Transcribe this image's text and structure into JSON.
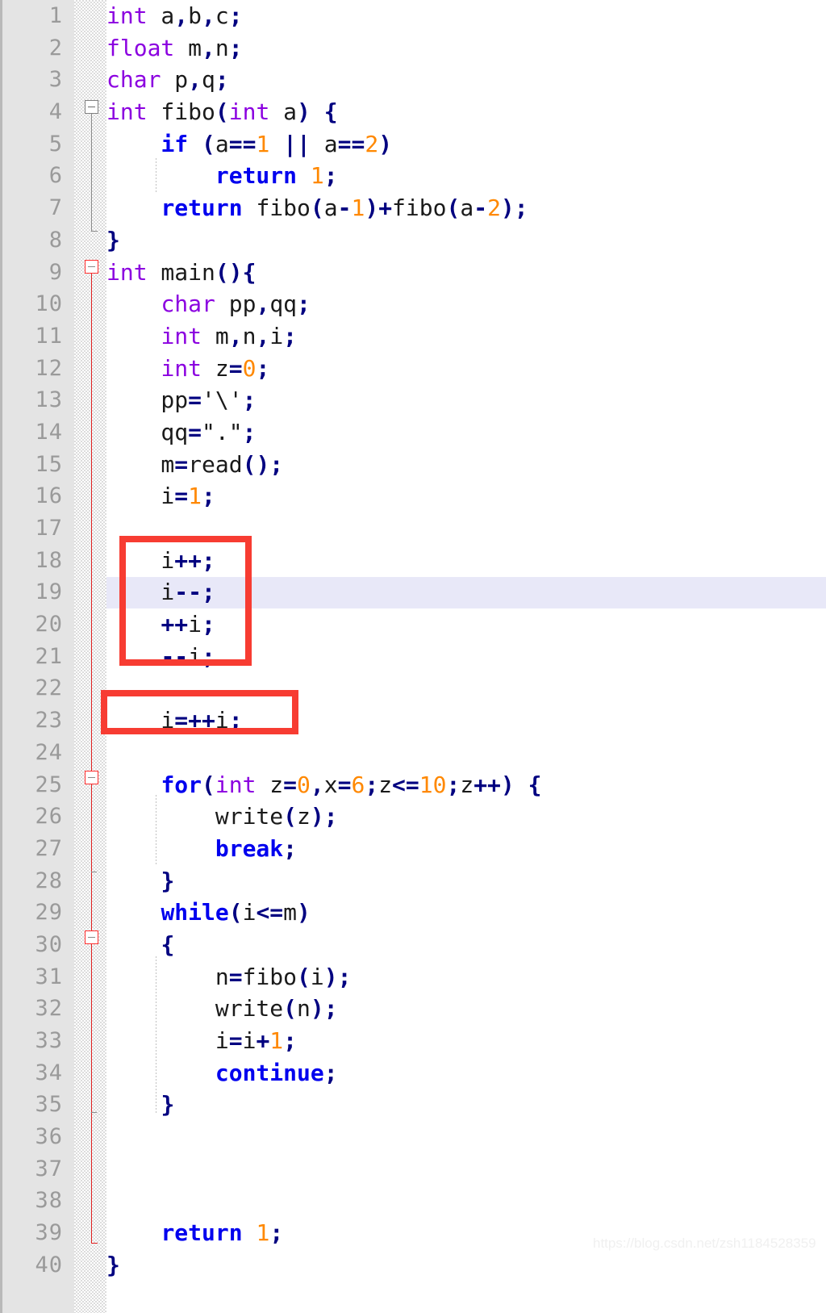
{
  "editor": {
    "language": "c",
    "first_line": 1,
    "last_line": 40,
    "highlighted_line": 19,
    "colors": {
      "background": "#ffffff",
      "gutter_background": "#e4e4e4",
      "line_number": "#9a9a9a",
      "current_line_highlight": "#e8e8f8",
      "type_keyword": "#8b00e0",
      "control_keyword": "#0000ee",
      "number_literal": "#ff8800",
      "punctuation": "#000080",
      "plain_text": "#1a1a1a",
      "annotation_box": "#f73c32",
      "scope_line_active": "#e02020",
      "scope_line_inactive": "#8a8a8a",
      "watermark": "#f0f0f0"
    }
  },
  "line_numbers": [
    "1",
    "2",
    "3",
    "4",
    "5",
    "6",
    "7",
    "8",
    "9",
    "10",
    "11",
    "12",
    "13",
    "14",
    "15",
    "16",
    "17",
    "18",
    "19",
    "20",
    "21",
    "22",
    "23",
    "24",
    "25",
    "26",
    "27",
    "28",
    "29",
    "30",
    "31",
    "32",
    "33",
    "34",
    "35",
    "36",
    "37",
    "38",
    "39",
    "40"
  ],
  "code_lines": [
    {
      "n": 1,
      "text": "int a,b,c;"
    },
    {
      "n": 2,
      "text": "float m,n;"
    },
    {
      "n": 3,
      "text": "char p,q;"
    },
    {
      "n": 4,
      "text": "int fibo(int a) {"
    },
    {
      "n": 5,
      "text": "    if (a==1 || a==2)"
    },
    {
      "n": 6,
      "text": "        return 1;"
    },
    {
      "n": 7,
      "text": "    return fibo(a-1)+fibo(a-2);"
    },
    {
      "n": 8,
      "text": "}"
    },
    {
      "n": 9,
      "text": "int main(){"
    },
    {
      "n": 10,
      "text": "    char pp,qq;"
    },
    {
      "n": 11,
      "text": "    int m,n,i;"
    },
    {
      "n": 12,
      "text": "    int z=0;"
    },
    {
      "n": 13,
      "text": "    pp='\\';"
    },
    {
      "n": 14,
      "text": "    qq=\".\";"
    },
    {
      "n": 15,
      "text": "    m=read();"
    },
    {
      "n": 16,
      "text": "    i=1;"
    },
    {
      "n": 17,
      "text": ""
    },
    {
      "n": 18,
      "text": "    i++;"
    },
    {
      "n": 19,
      "text": "    i--;"
    },
    {
      "n": 20,
      "text": "    ++i;"
    },
    {
      "n": 21,
      "text": "    --i;"
    },
    {
      "n": 22,
      "text": ""
    },
    {
      "n": 23,
      "text": "    i=++i;"
    },
    {
      "n": 24,
      "text": ""
    },
    {
      "n": 25,
      "text": "    for(int z=0,x=6;z<=10;z++) {"
    },
    {
      "n": 26,
      "text": "        write(z);"
    },
    {
      "n": 27,
      "text": "        break;"
    },
    {
      "n": 28,
      "text": "    }"
    },
    {
      "n": 29,
      "text": "    while(i<=m)"
    },
    {
      "n": 30,
      "text": "    {"
    },
    {
      "n": 31,
      "text": "        n=fibo(i);"
    },
    {
      "n": 32,
      "text": "        write(n);"
    },
    {
      "n": 33,
      "text": "        i=i+1;"
    },
    {
      "n": 34,
      "text": "        continue;"
    },
    {
      "n": 35,
      "text": "    }"
    },
    {
      "n": 36,
      "text": ""
    },
    {
      "n": 37,
      "text": ""
    },
    {
      "n": 38,
      "text": ""
    },
    {
      "n": 39,
      "text": "    return 1;"
    },
    {
      "n": 40,
      "text": "}"
    }
  ],
  "fold_markers": [
    {
      "line": 4,
      "state": "expanded",
      "color": "gray"
    },
    {
      "line": 9,
      "state": "expanded",
      "color": "red"
    },
    {
      "line": 25,
      "state": "expanded",
      "color": "red"
    },
    {
      "line": 30,
      "state": "expanded",
      "color": "red"
    }
  ],
  "annotations": [
    {
      "id": "box-increment-decrement",
      "covers_lines": [
        18,
        19,
        20,
        21
      ],
      "label": "i++; i--; ++i; --i;"
    },
    {
      "id": "box-self-assign-preincrement",
      "covers_lines": [
        23
      ],
      "label": "i=++i;"
    }
  ],
  "watermark": {
    "text": "https://blog.csdn.net/zsh1184528359"
  }
}
